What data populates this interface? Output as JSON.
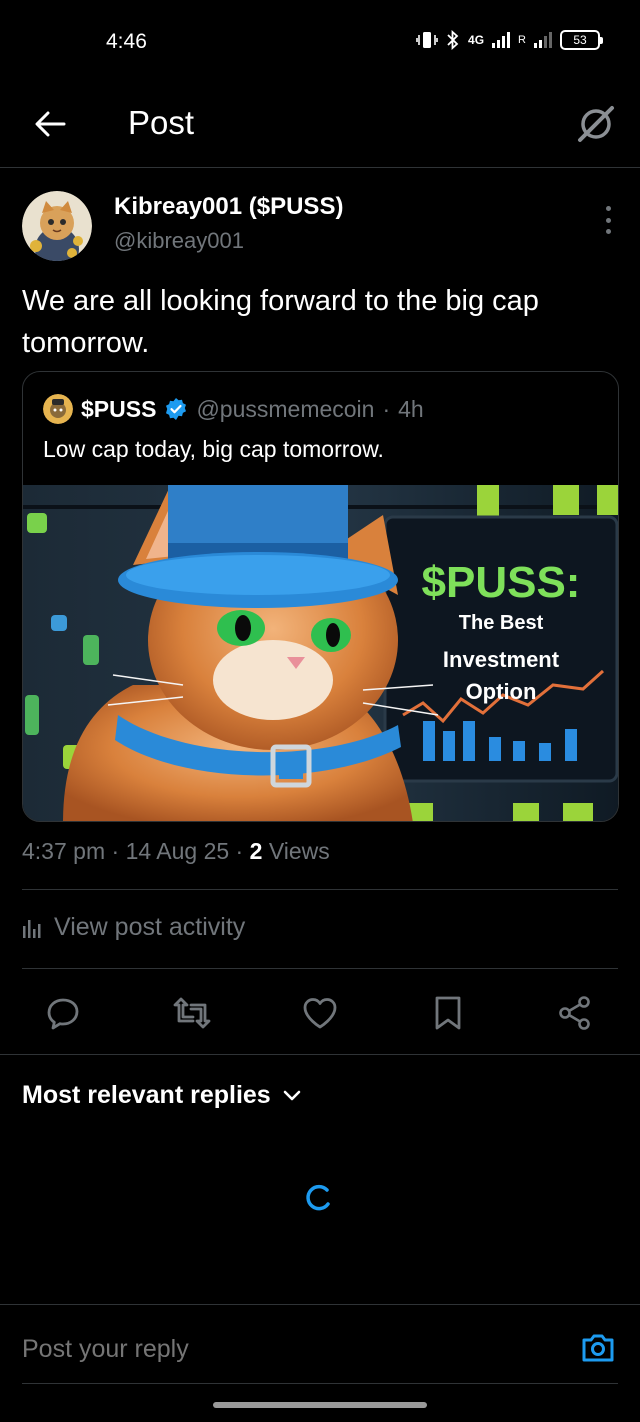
{
  "status_bar": {
    "time": "4:46",
    "network": "4G",
    "roaming": "R",
    "battery": "53"
  },
  "header": {
    "title": "Post",
    "back_icon": "arrow-left-icon",
    "grok_icon": "grok-icon"
  },
  "post": {
    "author_name": "Kibreay001 ($PUSS)",
    "author_handle": "@kibreay001",
    "text": "We are all looking forward to the big cap tomorrow.",
    "time": "4:37 pm",
    "date": "14 Aug 25",
    "views_count": "2",
    "views_label": "Views",
    "activity_label": "View post activity"
  },
  "quote": {
    "name": "$PUSS",
    "handle": "@pussmemecoin",
    "age": "4h",
    "text": "Low cap today, big cap tomorrow.",
    "image": {
      "headline": "$PUSS:",
      "line1": "The Best",
      "line2": "Investment",
      "line3": "Option"
    }
  },
  "actions": {
    "reply_icon": "reply-icon",
    "repost_icon": "repost-icon",
    "like_icon": "heart-icon",
    "bookmark_icon": "bookmark-icon",
    "share_icon": "share-icon"
  },
  "replies": {
    "sort_label": "Most relevant replies"
  },
  "reply_bar": {
    "placeholder": "Post your reply"
  },
  "colors": {
    "background": "#000000",
    "text": "#e7e9ea",
    "muted": "#71767b",
    "border": "#2f3336",
    "accent": "#1d9bf0"
  }
}
